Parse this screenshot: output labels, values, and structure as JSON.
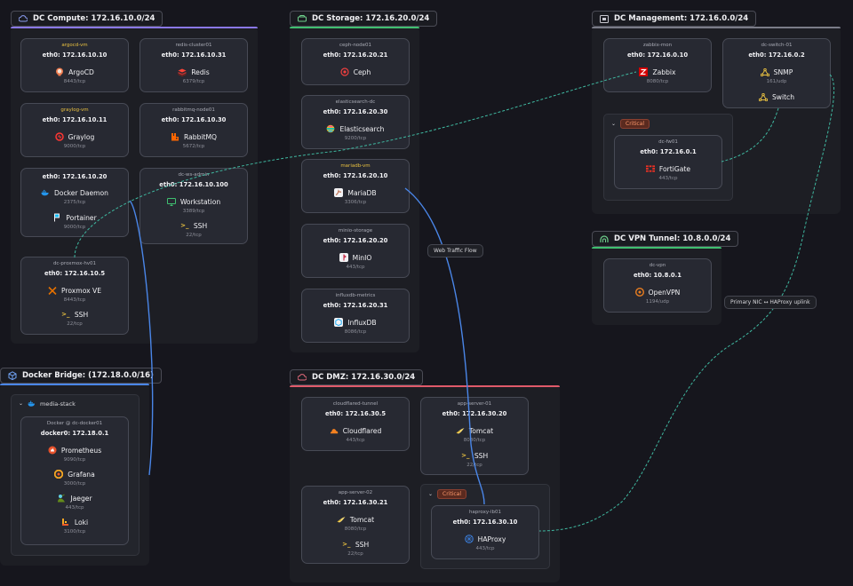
{
  "colors": {
    "background": "#16161d",
    "compute": "#8a78e6",
    "storage": "#3fbf70",
    "management": "#7a7c88",
    "vpn": "#3fbf70",
    "dmz": "#e05a6a",
    "docker": "#4a86e8",
    "edge_blue": "#4a86e8",
    "edge_teal": "#3fb8a0",
    "critical": "#ff9a6c"
  },
  "groups": {
    "compute": {
      "title": "DC Compute: 172.16.10.0/24",
      "icon": "cloud-icon"
    },
    "storage": {
      "title": "DC Storage: 172.16.20.0/24",
      "icon": "storage-icon"
    },
    "management": {
      "title": "DC Management: 172.16.0.0/24",
      "icon": "monitor-icon"
    },
    "vpn": {
      "title": "DC VPN Tunnel: 10.8.0.0/24",
      "icon": "tunnel-icon"
    },
    "dmz": {
      "title": "DC DMZ: 172.16.30.0/24",
      "icon": "cloud-icon"
    },
    "docker": {
      "title": "Docker Bridge: (172.18.0.0/16)",
      "icon": "cube-icon"
    }
  },
  "subgroups": {
    "media_stack": {
      "label": "media-stack",
      "icon": "docker-icon"
    },
    "mgmt_critical": {
      "label": "Critical"
    },
    "dmz_critical": {
      "label": "Critical"
    }
  },
  "nodes": {
    "argocd": {
      "name": "argocd-vm",
      "ip": "eth0: 172.16.10.10",
      "services": [
        {
          "label": "ArgoCD",
          "port": "8443/tcp",
          "icon": "argocd-icon"
        }
      ]
    },
    "redis": {
      "name": "redis-cluster01",
      "ip": "eth0: 172.16.10.31",
      "services": [
        {
          "label": "Redis",
          "port": "6379/tcp",
          "icon": "redis-icon"
        }
      ]
    },
    "graylog": {
      "name": "graylog-vm",
      "ip": "eth0: 172.16.10.11",
      "services": [
        {
          "label": "Graylog",
          "port": "9000/tcp",
          "icon": "graylog-icon"
        }
      ]
    },
    "rabbitmq": {
      "name": "rabbitmq-node01",
      "ip": "eth0: 172.16.10.30",
      "services": [
        {
          "label": "RabbitMQ",
          "port": "5672/tcp",
          "icon": "rabbitmq-icon"
        }
      ]
    },
    "docker_host": {
      "name": "",
      "ip": "eth0: 172.16.10.20",
      "services": [
        {
          "label": "Docker Daemon",
          "port": "2375/tcp",
          "icon": "docker-icon"
        },
        {
          "label": "Portainer",
          "port": "9000/tcp",
          "icon": "portainer-icon"
        }
      ]
    },
    "ws_admin": {
      "name": "dc-ws-admin",
      "ip": "eth0: 172.16.10.100",
      "services": [
        {
          "label": "Workstation",
          "port": "3389/tcp",
          "icon": "monitor-icon"
        },
        {
          "label": "SSH",
          "port": "22/tcp",
          "icon": "terminal-icon"
        }
      ]
    },
    "proxmox": {
      "name": "dc-proxmox-hv01",
      "ip": "eth0: 172.16.10.5",
      "services": [
        {
          "label": "Proxmox VE",
          "port": "8443/tcp",
          "icon": "proxmox-icon"
        },
        {
          "label": "SSH",
          "port": "22/tcp",
          "icon": "terminal-icon"
        }
      ]
    },
    "ceph": {
      "name": "ceph-node01",
      "ip": "eth0: 172.16.20.21",
      "services": [
        {
          "label": "Ceph",
          "port": "",
          "icon": "ceph-icon"
        }
      ]
    },
    "elastic": {
      "name": "elasticsearch-dc",
      "ip": "eth0: 172.16.20.30",
      "services": [
        {
          "label": "Elasticsearch",
          "port": "9200/tcp",
          "icon": "elasticsearch-icon"
        }
      ]
    },
    "mariadb": {
      "name": "mariadb-vm",
      "ip": "eth0: 172.16.20.10",
      "services": [
        {
          "label": "MariaDB",
          "port": "3306/tcp",
          "icon": "mariadb-icon"
        }
      ]
    },
    "minio": {
      "name": "minio-storage",
      "ip": "eth0: 172.16.20.20",
      "services": [
        {
          "label": "MinIO",
          "port": "443/tcp",
          "icon": "minio-icon"
        }
      ]
    },
    "influx": {
      "name": "influxdb-metrics",
      "ip": "eth0: 172.16.20.31",
      "services": [
        {
          "label": "InfluxDB",
          "port": "8086/tcp",
          "icon": "influxdb-icon"
        }
      ]
    },
    "zabbix": {
      "name": "zabbix-mon",
      "ip": "eth0: 172.16.0.10",
      "services": [
        {
          "label": "Zabbix",
          "port": "8080/tcp",
          "icon": "zabbix-icon"
        }
      ]
    },
    "switch": {
      "name": "dc-switch-01",
      "ip": "eth0: 172.16.0.2",
      "services": [
        {
          "label": "SNMP",
          "port": "161/udp",
          "icon": "switch-icon"
        },
        {
          "label": "Switch",
          "port": "",
          "icon": "switch-icon"
        }
      ]
    },
    "fw": {
      "name": "dc-fw01",
      "ip": "eth0: 172.16.0.1",
      "services": [
        {
          "label": "FortiGate",
          "port": "443/tcp",
          "icon": "fortigate-icon"
        }
      ]
    },
    "vpn": {
      "name": "dc-vpn",
      "ip": "eth0: 10.8.0.1",
      "services": [
        {
          "label": "OpenVPN",
          "port": "1194/udp",
          "icon": "openvpn-icon"
        }
      ]
    },
    "cloudflared": {
      "name": "cloudflared-tunnel",
      "ip": "eth0: 172.16.30.5",
      "services": [
        {
          "label": "Cloudflared",
          "port": "443/tcp",
          "icon": "cloudflare-icon"
        }
      ]
    },
    "app01": {
      "name": "app-server-01",
      "ip": "eth0: 172.16.30.20",
      "services": [
        {
          "label": "Tomcat",
          "port": "8080/tcp",
          "icon": "tomcat-icon"
        },
        {
          "label": "SSH",
          "port": "22/tcp",
          "icon": "terminal-icon"
        }
      ]
    },
    "app02": {
      "name": "app-server-02",
      "ip": "eth0: 172.16.30.21",
      "services": [
        {
          "label": "Tomcat",
          "port": "8080/tcp",
          "icon": "tomcat-icon"
        },
        {
          "label": "SSH",
          "port": "22/tcp",
          "icon": "terminal-icon"
        }
      ]
    },
    "haproxy": {
      "name": "haproxy-lb01",
      "ip": "eth0: 172.16.30.10",
      "services": [
        {
          "label": "HAProxy",
          "port": "443/tcp",
          "icon": "haproxy-icon"
        }
      ]
    },
    "docker01": {
      "name": "Docker @ dc-docker01",
      "ip": "docker0: 172.18.0.1",
      "services": [
        {
          "label": "Prometheus",
          "port": "9090/tcp",
          "icon": "prometheus-icon"
        },
        {
          "label": "Grafana",
          "port": "3000/tcp",
          "icon": "grafana-icon"
        },
        {
          "label": "Jaeger",
          "port": "443/tcp",
          "icon": "jaeger-icon"
        },
        {
          "label": "Loki",
          "port": "3100/tcp",
          "icon": "loki-icon"
        }
      ]
    }
  },
  "edge_labels": {
    "web_traffic": "Web Traffic Flow",
    "uplink": "Primary NIC ↔ HAProxy uplink"
  }
}
